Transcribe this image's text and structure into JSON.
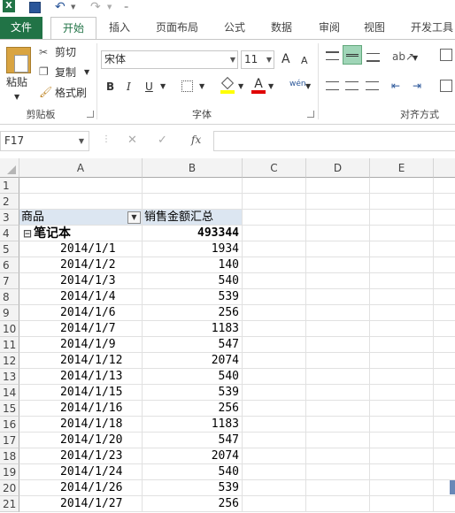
{
  "qat": {
    "excel_icon": "X",
    "undo": "↶",
    "redo": "↷",
    "customize": "₌"
  },
  "tabs": [
    "文件",
    "开始",
    "插入",
    "页面布局",
    "公式",
    "数据",
    "审阅",
    "视图",
    "开发工具"
  ],
  "ribbon": {
    "clipboard": {
      "paste": "粘贴",
      "cut": "剪切",
      "copy": "复制",
      "format_painter": "格式刷",
      "label": "剪贴板"
    },
    "font": {
      "name": "宋体",
      "size": "11",
      "grow": "A",
      "shrink": "A",
      "bold": "B",
      "italic": "I",
      "underline": "U",
      "font_color": "A",
      "phonetic": "wén",
      "label": "字体"
    },
    "alignment": {
      "label": "对齐方式"
    }
  },
  "formula_bar": {
    "name_box": "F17",
    "fx": "fx",
    "cancel": "✕",
    "enter": "✓"
  },
  "columns": [
    "A",
    "B",
    "C",
    "D",
    "E"
  ],
  "row_numbers": [
    "1",
    "2",
    "3",
    "4",
    "5",
    "6",
    "7",
    "8",
    "9",
    "10",
    "11",
    "12",
    "13",
    "14",
    "15",
    "16",
    "17",
    "18",
    "19",
    "20",
    "21"
  ],
  "pivot": {
    "header_product": "商品",
    "header_sales": "销售金额汇总",
    "group_label": "笔记本",
    "group_total": "493344",
    "collapse_symbol": "⊟",
    "rows": [
      {
        "date": "2014/1/1",
        "value": "1934"
      },
      {
        "date": "2014/1/2",
        "value": "140"
      },
      {
        "date": "2014/1/3",
        "value": "540"
      },
      {
        "date": "2014/1/4",
        "value": "539"
      },
      {
        "date": "2014/1/6",
        "value": "256"
      },
      {
        "date": "2014/1/7",
        "value": "1183"
      },
      {
        "date": "2014/1/9",
        "value": "547"
      },
      {
        "date": "2014/1/12",
        "value": "2074"
      },
      {
        "date": "2014/1/13",
        "value": "540"
      },
      {
        "date": "2014/1/15",
        "value": "539"
      },
      {
        "date": "2014/1/16",
        "value": "256"
      },
      {
        "date": "2014/1/18",
        "value": "1183"
      },
      {
        "date": "2014/1/20",
        "value": "547"
      },
      {
        "date": "2014/1/23",
        "value": "2074"
      },
      {
        "date": "2014/1/24",
        "value": "540"
      },
      {
        "date": "2014/1/26",
        "value": "539"
      },
      {
        "date": "2014/1/27",
        "value": "256"
      }
    ]
  }
}
